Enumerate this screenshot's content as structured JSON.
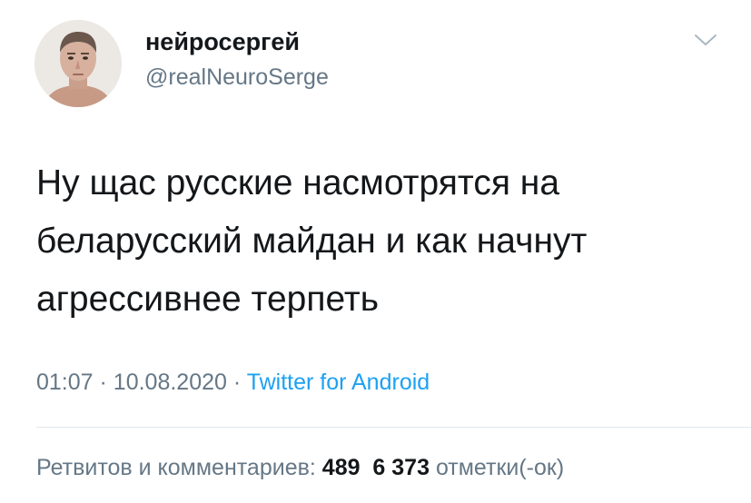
{
  "author": {
    "display_name": "нейросергей",
    "handle": "@realNeuroSerge",
    "avatar_icon": "profile-photo"
  },
  "tweet": {
    "text": "Ну щас русские насмотрятся на\nбеларусский майдан и как начнут\nагрессивнее терпеть",
    "time": "01:07",
    "date": "10.08.2020",
    "separator": "·",
    "source": "Twitter for Android"
  },
  "stats": {
    "label": "Ретвитов и комментариев:",
    "retweets": "489",
    "likes": "6 373",
    "likes_label": "отметки(-ок)"
  },
  "colors": {
    "text": "#14171a",
    "secondary": "#657786",
    "link": "#1da1f2",
    "divider": "#e1e8ed"
  },
  "icons": {
    "menu": "chevron-down-icon"
  }
}
